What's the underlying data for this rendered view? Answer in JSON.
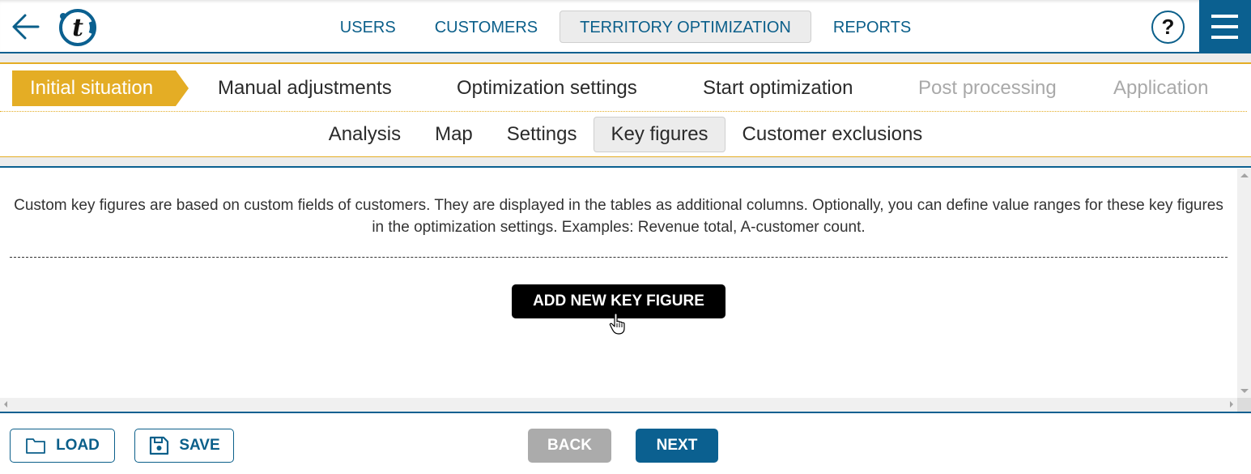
{
  "header": {
    "back_icon": "arrow-left-icon",
    "logo_icon": "t-logo-icon",
    "nav": [
      {
        "label": "USERS",
        "active": false
      },
      {
        "label": "CUSTOMERS",
        "active": false
      },
      {
        "label": "TERRITORY OPTIMIZATION",
        "active": true
      },
      {
        "label": "REPORTS",
        "active": false
      }
    ],
    "help_label": "?",
    "menu_icon": "hamburger-menu-icon"
  },
  "steps": [
    {
      "label": "Initial situation",
      "state": "active"
    },
    {
      "label": "Manual adjustments",
      "state": "enabled"
    },
    {
      "label": "Optimization settings",
      "state": "enabled"
    },
    {
      "label": "Start optimization",
      "state": "enabled"
    },
    {
      "label": "Post processing",
      "state": "disabled"
    },
    {
      "label": "Application",
      "state": "disabled"
    }
  ],
  "subtabs": [
    {
      "label": "Analysis",
      "active": false
    },
    {
      "label": "Map",
      "active": false
    },
    {
      "label": "Settings",
      "active": false
    },
    {
      "label": "Key figures",
      "active": true
    },
    {
      "label": "Customer exclusions",
      "active": false
    }
  ],
  "content": {
    "description": "Custom key figures are based on custom fields of customers. They are displayed in the tables as additional columns. Optionally, you can define value ranges for these key figures in the optimization settings. Examples: Revenue total, A-customer count.",
    "add_button_label": "ADD NEW KEY FIGURE"
  },
  "footer": {
    "load_label": "LOAD",
    "save_label": "SAVE",
    "back_label": "BACK",
    "next_label": "NEXT"
  },
  "colors": {
    "brand_blue": "#0b6090",
    "accent_gold": "#e4ad25",
    "disabled_gray": "#ababab"
  }
}
